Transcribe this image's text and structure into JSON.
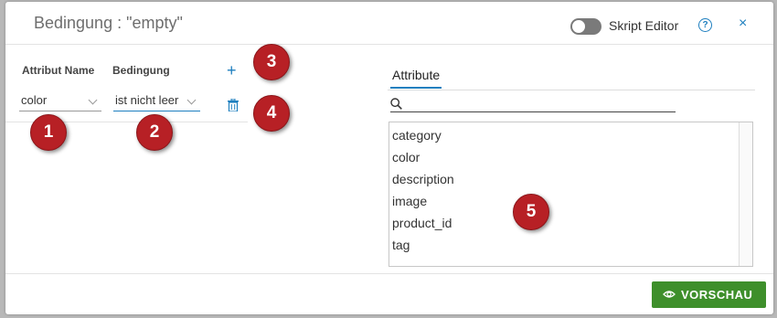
{
  "dialog": {
    "title": "Bedingung : \"empty\""
  },
  "header": {
    "toggle_label": "Skript Editor",
    "help_glyph": "?",
    "close_glyph": "×"
  },
  "condition_form": {
    "col_attribute_header": "Attribut Name",
    "col_condition_header": "Bedingung",
    "attribute_value": "color",
    "condition_value": "ist nicht leer",
    "add_glyph": "+"
  },
  "attributes_panel": {
    "tab_label": "Attribute",
    "search_placeholder": "",
    "items": [
      "category",
      "color",
      "description",
      "image",
      "product_id",
      "tag"
    ]
  },
  "annotations": [
    "1",
    "2",
    "3",
    "4",
    "5"
  ],
  "footer": {
    "preview_label": "VORSCHAU"
  },
  "colors": {
    "accent": "#1e7fbf",
    "badge": "#b72025",
    "button": "#3e8f2b"
  }
}
